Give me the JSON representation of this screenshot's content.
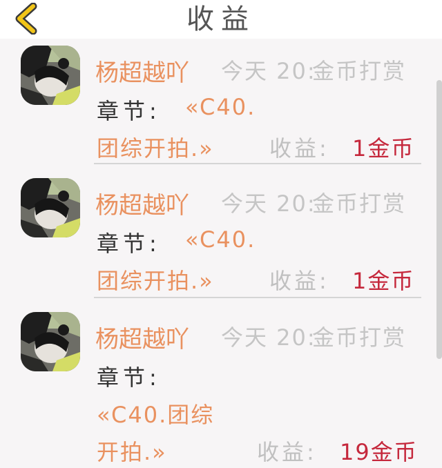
{
  "header": {
    "title": "收益",
    "back_icon": "chevron-left-icon",
    "back_color": "#f2c518"
  },
  "items": [
    {
      "name": "杨超越吖",
      "time": "今天 20:",
      "type": "金币打赏",
      "chapter_label": "章节:",
      "chapter_line1": "«C40.",
      "chapter_line2": "团综开拍.»",
      "income_label": "收益:",
      "income_value": "1金币"
    },
    {
      "name": "杨超越吖",
      "time": "今天 20:",
      "type": "金币打赏",
      "chapter_label": "章节:",
      "chapter_line1": "«C40.",
      "chapter_line2": "团综开拍.»",
      "income_label": "收益:",
      "income_value": "1金币"
    },
    {
      "name": "杨超越吖",
      "time": "今天 20:",
      "type": "金币打赏",
      "chapter_label": "章节:",
      "chapter_line1": "«C40.团综",
      "chapter_line2": "开拍.»",
      "income_label": "收益:",
      "income_value": "19金币"
    }
  ],
  "colors": {
    "name": "#e9915f",
    "chapter": "#e9915f",
    "income": "#c5283c",
    "muted": "#c5c5c5"
  }
}
